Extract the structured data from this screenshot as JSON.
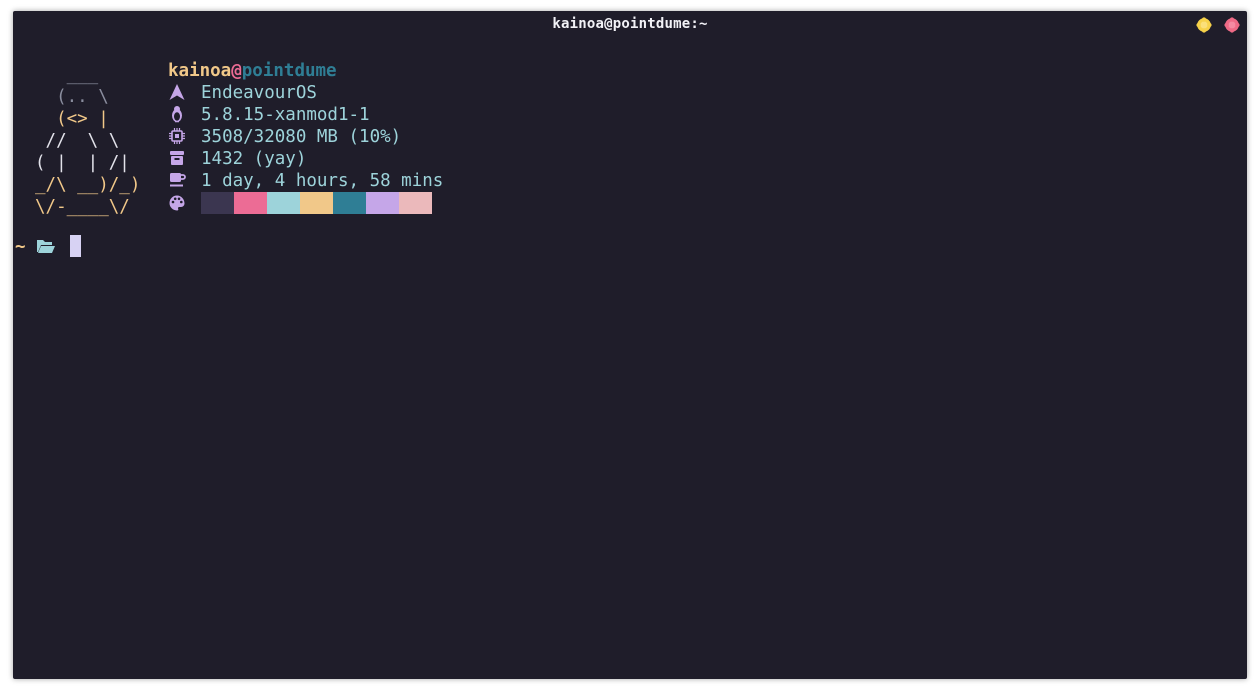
{
  "window": {
    "title": "kainoa@pointdume:~",
    "buttons": {
      "minimize_color": "#f7d24a",
      "close_color": "#ef6a86"
    }
  },
  "neofetch": {
    "ascii_art": [
      "   ___",
      "  (.. \\",
      "  (<> |",
      " //  \\ \\",
      "( |  | /|",
      "_/\\ __)/_)",
      "\\/-____\\/"
    ],
    "user": "kainoa",
    "at": "@",
    "host": "pointdume",
    "rows": [
      {
        "icon": "arch-logo-icon",
        "text": "EndeavourOS"
      },
      {
        "icon": "penguin-icon",
        "text": "5.8.15-xanmod1-1"
      },
      {
        "icon": "chip-icon",
        "text": "3508/32080 MB (10%)"
      },
      {
        "icon": "package-icon",
        "text": "1432 (yay)"
      },
      {
        "icon": "coffee-icon",
        "text": "1 day, 4 hours, 58 mins"
      }
    ],
    "palette_icon": "palette-icon",
    "palette": [
      "#3b3650",
      "#ec6c95",
      "#9dd3da",
      "#f1c889",
      "#2f7e95",
      "#c5a6e8",
      "#ebb9bb"
    ]
  },
  "prompt": {
    "path": "~",
    "folder_icon": "folder-open-icon"
  }
}
